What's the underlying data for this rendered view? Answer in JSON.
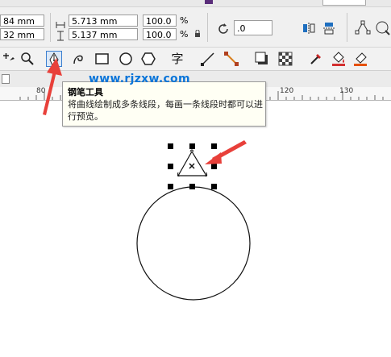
{
  "property_bar": {
    "x_value": "84 mm",
    "y_value": "32 mm",
    "width_value": "5.713 mm",
    "height_value": "5.137 mm",
    "scale_x": "100.0",
    "scale_y": "100.0",
    "percent_symbol": "%",
    "rotation_value": ".0"
  },
  "toolbox": {
    "tools": [
      "pick-tool",
      "zoom-tool",
      "pen-tool",
      "freehand-tool",
      "rectangle-tool",
      "ellipse-tool",
      "polygon-tool",
      "text-tool",
      "connector-tool",
      "dimension-tool",
      "drop-shadow-tool",
      "transparency-tool",
      "eyedropper-tool",
      "fill-tool",
      "smart-fill-tool"
    ],
    "active_tool": "pen-tool",
    "text_tool_glyph": "字"
  },
  "ruler": {
    "labels": [
      "80",
      "120",
      "130"
    ]
  },
  "tooltip": {
    "title": "钢笔工具",
    "body": "将曲线绘制成多条线段，每画一条线段时都可以进行预览。"
  },
  "watermark": "www.rjzxw.com",
  "colors": {
    "arrow": "#e8403a",
    "watermark": "#0a75d9",
    "toolbar_bg": "#f0f0f0",
    "tooltip_bg": "#fffff4"
  }
}
